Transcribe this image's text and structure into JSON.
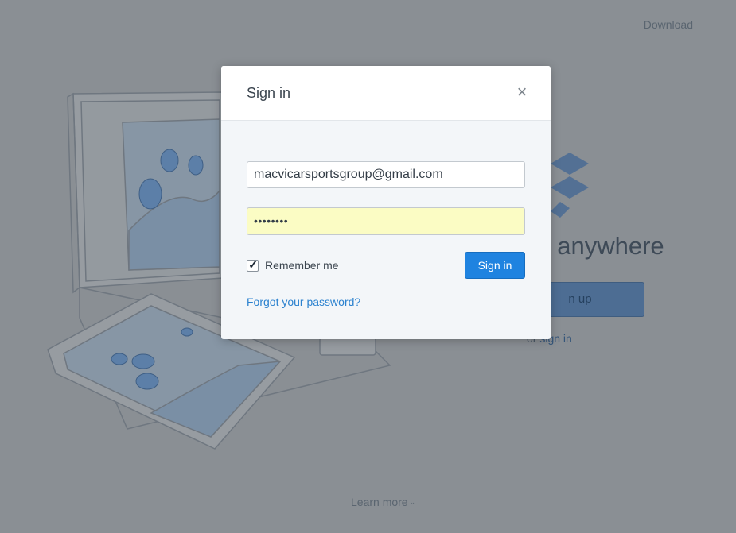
{
  "background": {
    "download_label": "Download",
    "tagline": ", anywhere",
    "signup_label": "n up",
    "or_label": "or",
    "signin_label": "sign in",
    "learn_more_label": "Learn more",
    "chevron_icon": "chevron-down-icon",
    "logo_icon": "dropbox-logo-icon"
  },
  "modal": {
    "title": "Sign in",
    "close_icon": "close-icon",
    "email_value": "macvicarsportsgroup@gmail.com",
    "password_masked": "••••••••",
    "remember_label": "Remember me",
    "remember_checked": true,
    "signin_button": "Sign in",
    "forgot_link": "Forgot your password?"
  },
  "colors": {
    "overlay": "#8a8f94",
    "accent": "#1f83e0",
    "link": "#2c82cf",
    "autofill": "#fbfcc4"
  }
}
